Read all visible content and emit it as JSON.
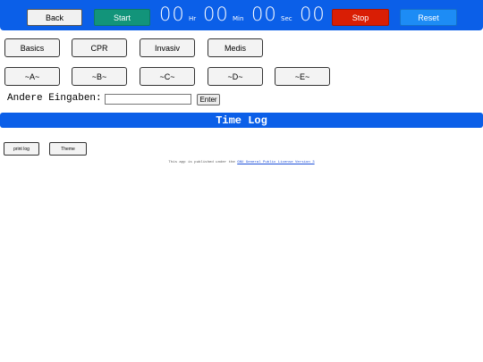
{
  "toolbar": {
    "back_label": "Back",
    "start_label": "Start",
    "stop_label": "Stop",
    "reset_label": "Reset"
  },
  "timer": {
    "hours": "00",
    "hours_unit": "Hr",
    "minutes": "00",
    "minutes_unit": "Min",
    "seconds": "00",
    "seconds_unit": "Sec",
    "hundredths": "00"
  },
  "categories": {
    "row1": [
      "Basics",
      "CPR",
      "Invasiv",
      "Medis"
    ],
    "row2": [
      "~A~",
      "~B~",
      "~C~",
      "~D~",
      "~E~"
    ]
  },
  "other_input": {
    "label": "Andere Eingaben:",
    "value": "",
    "enter_label": "Enter"
  },
  "timelog": {
    "title": "Time Log"
  },
  "footer_buttons": {
    "print_label": "print log",
    "theme_label": "Theme"
  },
  "license": {
    "prefix": "This app is published under the",
    "link_text": "GNU General Public License Version 3"
  },
  "colors": {
    "header_blue": "#0b5fe8",
    "start_green": "#12947a",
    "stop_red": "#d91e05",
    "reset_blue": "#1d8cf5"
  }
}
